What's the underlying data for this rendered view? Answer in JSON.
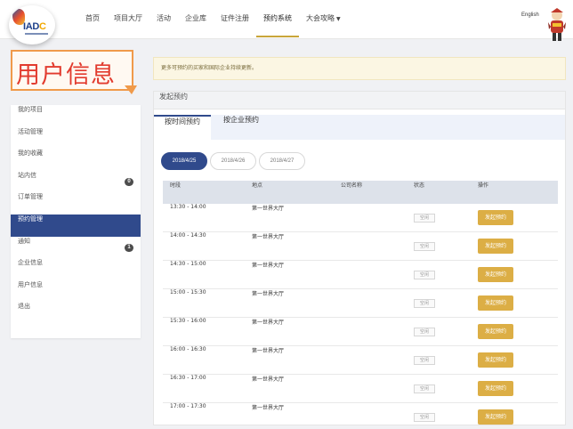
{
  "header": {
    "logo_text": "IADC",
    "nav": [
      {
        "label": "首页"
      },
      {
        "label": "项目大厅"
      },
      {
        "label": "活动"
      },
      {
        "label": "企业库"
      },
      {
        "label": "证件注册"
      },
      {
        "label": "预约系统",
        "active": true
      },
      {
        "label": "大会攻略",
        "has_dropdown": true
      }
    ],
    "language": "English",
    "accent_color": "#c9a63a"
  },
  "annotation": {
    "label": "用户信息",
    "color": "#e23b2e",
    "border_color": "#f09a4a"
  },
  "sidebar": {
    "items": [
      {
        "label": "我的项目"
      },
      {
        "label": "活动管理"
      },
      {
        "label": "我的收藏"
      },
      {
        "label": "站内信",
        "badge": "0"
      },
      {
        "label": "订单管理"
      },
      {
        "label": "预约管理",
        "active": true
      },
      {
        "label": "通知",
        "badge": "1"
      },
      {
        "label": "企业信息"
      },
      {
        "label": "用户信息"
      },
      {
        "label": "退出"
      }
    ],
    "active_color": "#304a8c"
  },
  "notice": {
    "text": "更多可预约的买家和国际企业持续更新。"
  },
  "panel": {
    "title": "发起预约",
    "tabs": [
      {
        "label": "按时间预约",
        "active": true
      },
      {
        "label": "按企业预约"
      }
    ],
    "dates": [
      {
        "label": "2018/4/25",
        "active": true
      },
      {
        "label": "2018/4/26"
      },
      {
        "label": "2018/4/27"
      }
    ],
    "table": {
      "headers": [
        "时段",
        "地点",
        "公司名称",
        "状态",
        "操作"
      ],
      "rows": [
        {
          "time": "13:30 - 14:00",
          "location": "第一世界大厅",
          "company": "",
          "status": "空闲",
          "action": "发起预约"
        },
        {
          "time": "14:00 - 14:30",
          "location": "第一世界大厅",
          "company": "",
          "status": "空闲",
          "action": "发起预约"
        },
        {
          "time": "14:30 - 15:00",
          "location": "第一世界大厅",
          "company": "",
          "status": "空闲",
          "action": "发起预约"
        },
        {
          "time": "15:00 - 15:30",
          "location": "第一世界大厅",
          "company": "",
          "status": "空闲",
          "action": "发起预约"
        },
        {
          "time": "15:30 - 16:00",
          "location": "第一世界大厅",
          "company": "",
          "status": "空闲",
          "action": "发起预约"
        },
        {
          "time": "16:00 - 16:30",
          "location": "第一世界大厅",
          "company": "",
          "status": "空闲",
          "action": "发起预约"
        },
        {
          "time": "16:30 - 17:00",
          "location": "第一世界大厅",
          "company": "",
          "status": "空闲",
          "action": "发起预约"
        },
        {
          "time": "17:00 - 17:30",
          "location": "第一世界大厅",
          "company": "",
          "status": "空闲",
          "action": "发起预约"
        }
      ]
    },
    "button_color": "#dcae45"
  }
}
